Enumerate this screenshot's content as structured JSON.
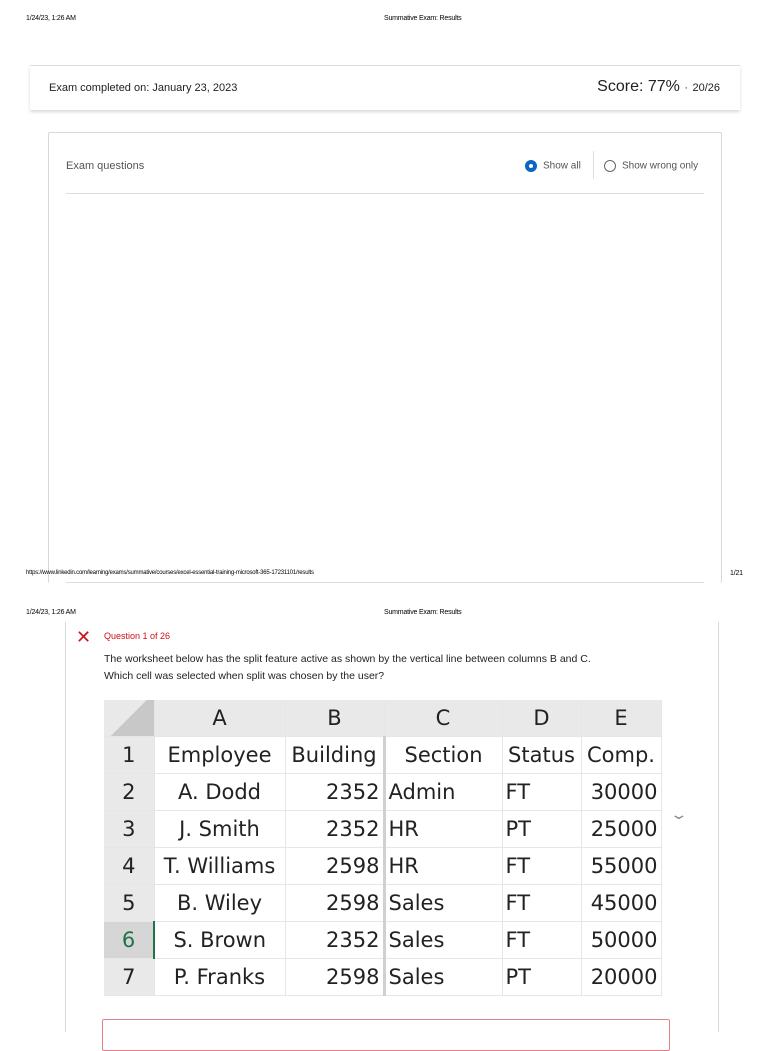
{
  "print_header": {
    "datetime": "1/24/23, 1:26 AM",
    "title": "Summative Exam: Results"
  },
  "print_footer": {
    "url": "https://www.linkedin.com/learning/exams/summative/courses/excel-essential-training-microsoft-365-17231101/results",
    "page": "1/21"
  },
  "summary": {
    "completed": "Exam completed on: January 23, 2023",
    "score_label": "Score: 77%",
    "separator": "·",
    "score_fraction": "20/26"
  },
  "questions_panel": {
    "title": "Exam questions",
    "filter_options": [
      {
        "label": "Show all",
        "selected": true
      },
      {
        "label": "Show wrong only",
        "selected": false
      }
    ]
  },
  "question": {
    "status": "incorrect",
    "number_label": "Question 1 of 26",
    "text_line1": "The worksheet below has the split feature active as shown by the vertical line between columns B and C.",
    "text_line2": "Which cell was selected when split was chosen by the user?"
  },
  "spreadsheet": {
    "columns": [
      "A",
      "B",
      "C",
      "D",
      "E"
    ],
    "rows": [
      {
        "n": "1",
        "cells": [
          "Employee",
          "Building",
          "Section",
          "Status",
          "Comp."
        ]
      },
      {
        "n": "2",
        "cells": [
          "A. Dodd",
          "2352",
          "Admin",
          "FT",
          "30000"
        ]
      },
      {
        "n": "3",
        "cells": [
          "J. Smith",
          "2352",
          "HR",
          "PT",
          "25000"
        ]
      },
      {
        "n": "4",
        "cells": [
          "T. Williams",
          "2598",
          "HR",
          "FT",
          "55000"
        ]
      },
      {
        "n": "5",
        "cells": [
          "B. Wiley",
          "2598",
          "Sales",
          "FT",
          "45000"
        ]
      },
      {
        "n": "6",
        "cells": [
          "S. Brown",
          "2352",
          "Sales",
          "FT",
          "50000"
        ]
      },
      {
        "n": "7",
        "cells": [
          "P. Franks",
          "2598",
          "Sales",
          "PT",
          "20000"
        ]
      }
    ]
  },
  "colors": {
    "accent": "#0a66c2",
    "error": "#cc1016"
  }
}
